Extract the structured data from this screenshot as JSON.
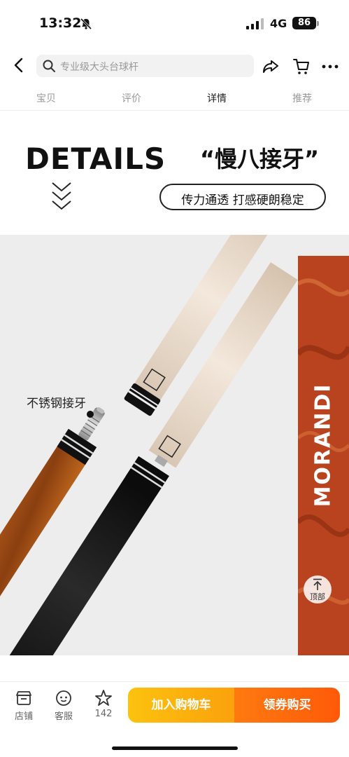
{
  "status_bar": {
    "time": "13:32",
    "network": "4G",
    "battery": "86"
  },
  "nav": {
    "search_placeholder": "专业级大头台球杆"
  },
  "tabs": [
    {
      "label": "宝贝",
      "active": false
    },
    {
      "label": "评价",
      "active": false
    },
    {
      "label": "详情",
      "active": true
    },
    {
      "label": "推荐",
      "active": false
    }
  ],
  "banner": {
    "title": "DETAILS",
    "slogan": "“慢八接牙”",
    "pill": "传力通透 打感硬朗稳定"
  },
  "product": {
    "callout": "不锈钢接牙",
    "brand": "MORANDI",
    "top_button": "顶部"
  },
  "bottom_bar": {
    "shop": "店铺",
    "service": "客服",
    "favorites_count": "142",
    "add_to_cart": "加入购物车",
    "buy_coupon": "领券购买"
  },
  "colors": {
    "cart_gradient_start": "#fcc20f",
    "buy_gradient_end": "#fe5a08",
    "wood": "#b8431e"
  }
}
